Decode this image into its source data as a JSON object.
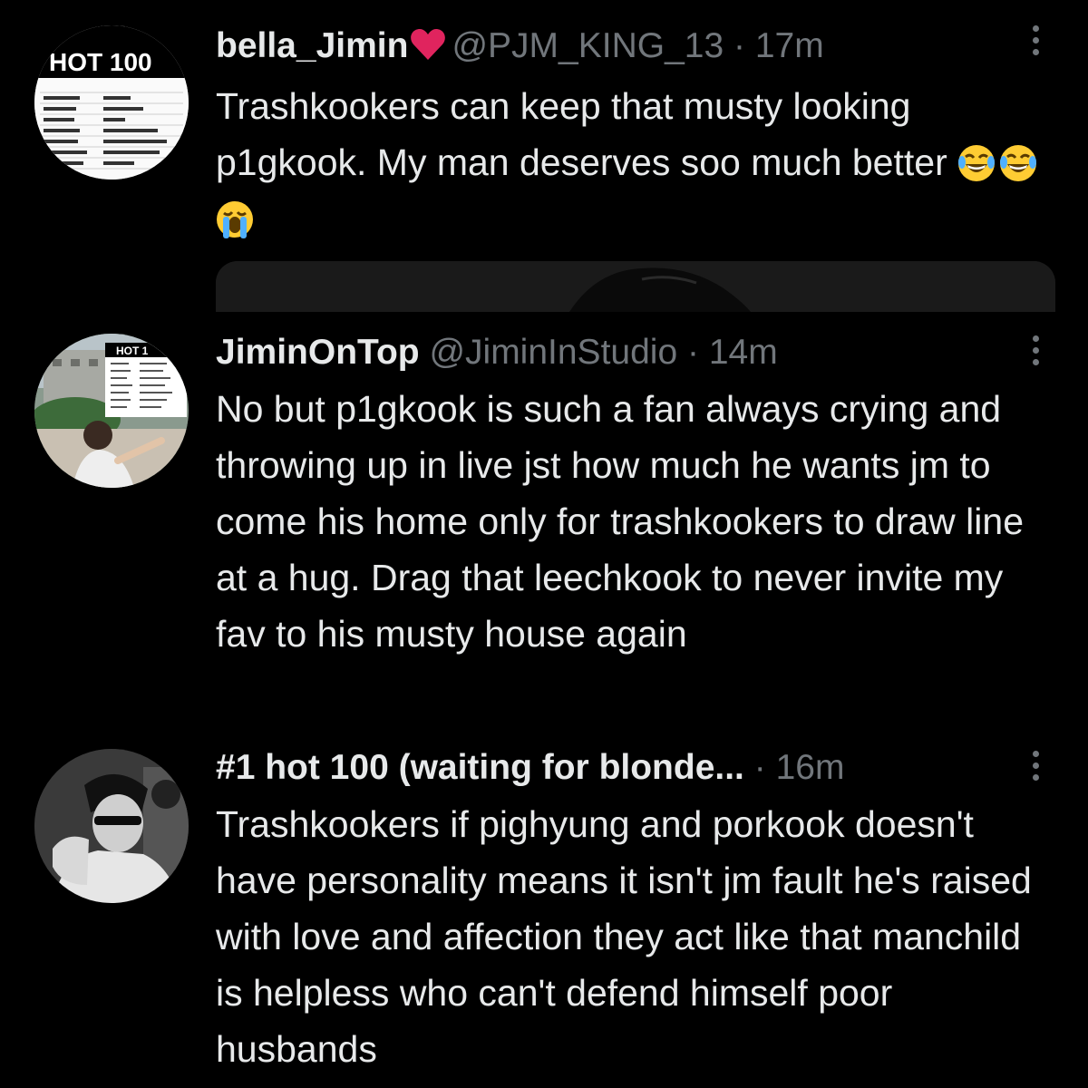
{
  "tweets": [
    {
      "display_name": "bella_Jimin",
      "handle": "@PJM_KING_13",
      "separator": "·",
      "time": "17m",
      "text": "Trashkookers can keep that musty looking p1gkook. My man deserves soo much better",
      "emojis": [
        "face-with-tears-of-joy",
        "face-with-tears-of-joy",
        "loudly-crying-face"
      ],
      "avatar_text": "HOT 100"
    },
    {
      "display_name": "JiminOnTop",
      "handle": "@JiminInStudio",
      "separator": "·",
      "time": "14m",
      "text": "No but p1gkook is such a fan always crying and throwing up in live jst how much he wants jm to come his home only for trashkookers to draw line at a hug. Drag that leechkook to never invite my fav to his musty house again",
      "avatar_text": "HOT 1"
    },
    {
      "display_name": "#1 hot 100 (waiting for blonde...",
      "handle": "",
      "separator": "·",
      "time": "16m",
      "text": "Trashkookers if pighyung and porkook doesn't have personality means it isn't jm fault he's raised with love and affection they act like that manchild is helpless who can't defend himself poor husbands"
    }
  ],
  "colors": {
    "background": "#000000",
    "primary_text": "#e7e9ea",
    "secondary_text": "#71767b",
    "heart": "#e0245e"
  },
  "icons": [
    "heart-icon",
    "more-options-icon"
  ]
}
